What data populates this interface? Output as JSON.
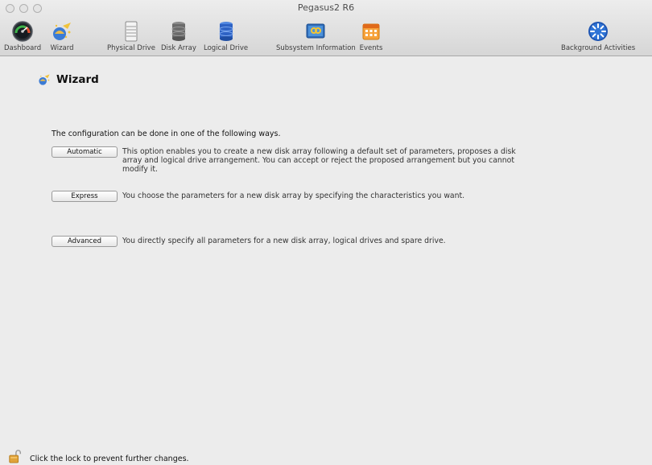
{
  "window": {
    "title": "Pegasus2 R6"
  },
  "toolbar": {
    "items": [
      {
        "label": "Dashboard",
        "icon": "dashboard-gauge-icon"
      },
      {
        "label": "Wizard",
        "icon": "wizard-icon"
      },
      {
        "label": "Physical Drive",
        "icon": "physical-drive-icon"
      },
      {
        "label": "Disk Array",
        "icon": "disk-array-icon"
      },
      {
        "label": "Logical Drive",
        "icon": "logical-drive-icon"
      },
      {
        "label": "Subsystem Information",
        "icon": "subsystem-information-icon"
      },
      {
        "label": "Events",
        "icon": "events-calendar-icon"
      },
      {
        "label": "Background Activities",
        "icon": "background-activities-icon"
      }
    ]
  },
  "page": {
    "title": "Wizard",
    "intro": "The configuration can be done in one of the following ways.",
    "options": [
      {
        "button": "Automatic",
        "description": "This option enables you to create a new disk array following a default set of parameters, proposes a disk array and logical drive arrangement. You can accept or reject the proposed arrangement but you cannot modify it."
      },
      {
        "button": "Express",
        "description": "You choose the parameters for a new disk array by specifying the characteristics you want."
      },
      {
        "button": "Advanced",
        "description": "You directly specify all parameters for a new disk array, logical drives and spare drive."
      }
    ]
  },
  "footer": {
    "lock_text": "Click the lock to prevent further changes."
  },
  "colors": {
    "window_bg": "#ececec",
    "toolbar_border": "#a8a8a8"
  }
}
